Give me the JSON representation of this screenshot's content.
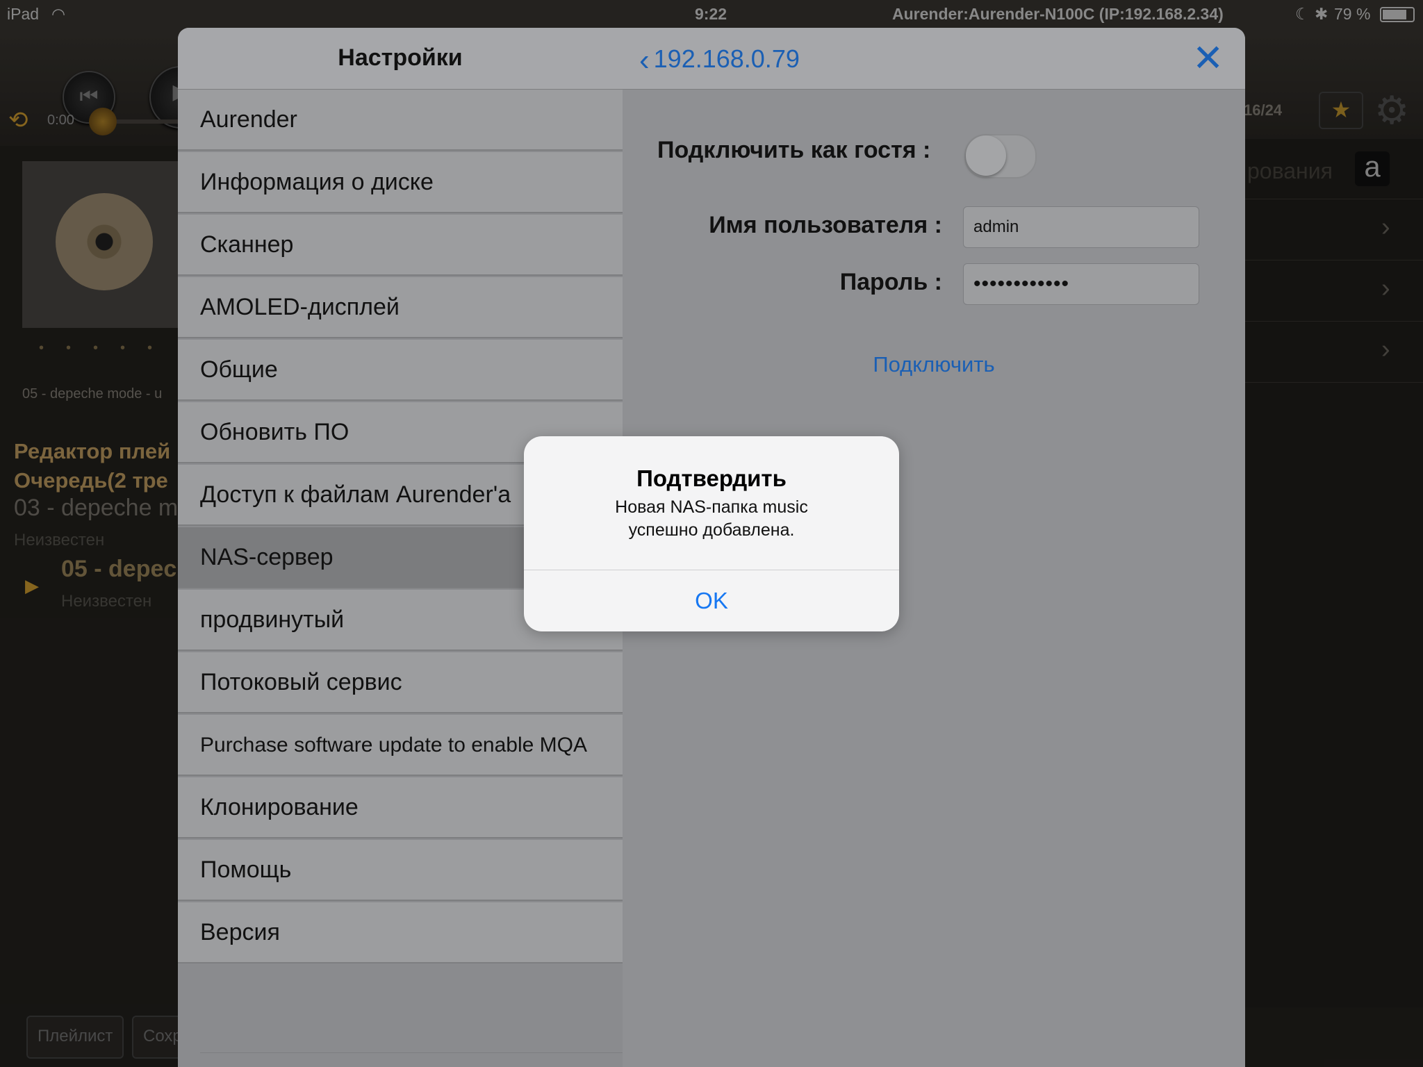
{
  "status_bar": {
    "device": "iPad",
    "time": "9:22",
    "device_connection": "Aurender:Aurender-N100C (IP:192.168.2.34)",
    "battery": "79 %"
  },
  "player": {
    "elapsed": "0:00",
    "track_counter": "16/24",
    "now_playing_file": "05 - depeche mode - u",
    "playlist_editor_title": "Редактор плей",
    "queue_title": "Очередь(2 тре",
    "queue": [
      {
        "title": "03 - depeche m",
        "artist": "Неизвестен"
      },
      {
        "title": "05 - depec",
        "artist": "Неизвестен"
      }
    ],
    "bottom_buttons": [
      "Плейлист",
      "Сохр"
    ],
    "right_header": "рования",
    "amazon_letter": "a"
  },
  "settings": {
    "title": "Настройки",
    "back_label": "192.168.0.79",
    "menu": [
      {
        "label": "Aurender"
      },
      {
        "label": "Информация о диске"
      },
      {
        "label": "Сканнер"
      },
      {
        "label": "AMOLED-дисплей"
      },
      {
        "label": "Общие"
      },
      {
        "label": "Обновить ПО"
      },
      {
        "label": "Доступ к файлам Aurender'a"
      },
      {
        "label": "NAS-сервер"
      },
      {
        "label": "продвинутый"
      },
      {
        "label": "Потоковый сервис"
      },
      {
        "label": "Purchase software update to enable MQA"
      },
      {
        "label": "Клонирование"
      },
      {
        "label": "Помощь"
      },
      {
        "label": "Версия"
      }
    ],
    "selected_index": 7,
    "detail": {
      "guest_label": "Подключить как гостя :",
      "guest_enabled": false,
      "username_label": "Имя пользователя :",
      "username_value": "admin",
      "password_label": "Пароль :",
      "password_value": "••••••••••••",
      "connect_label": "Подключить"
    }
  },
  "alert": {
    "title": "Подтвердить",
    "message_line1": "Новая NAS-папка music",
    "message_line2": "успешно добавлена.",
    "ok_label": "OK"
  },
  "colors": {
    "accent": "#1a5fb4",
    "alert_button": "#1677f2",
    "player_gold": "#d9a431"
  }
}
